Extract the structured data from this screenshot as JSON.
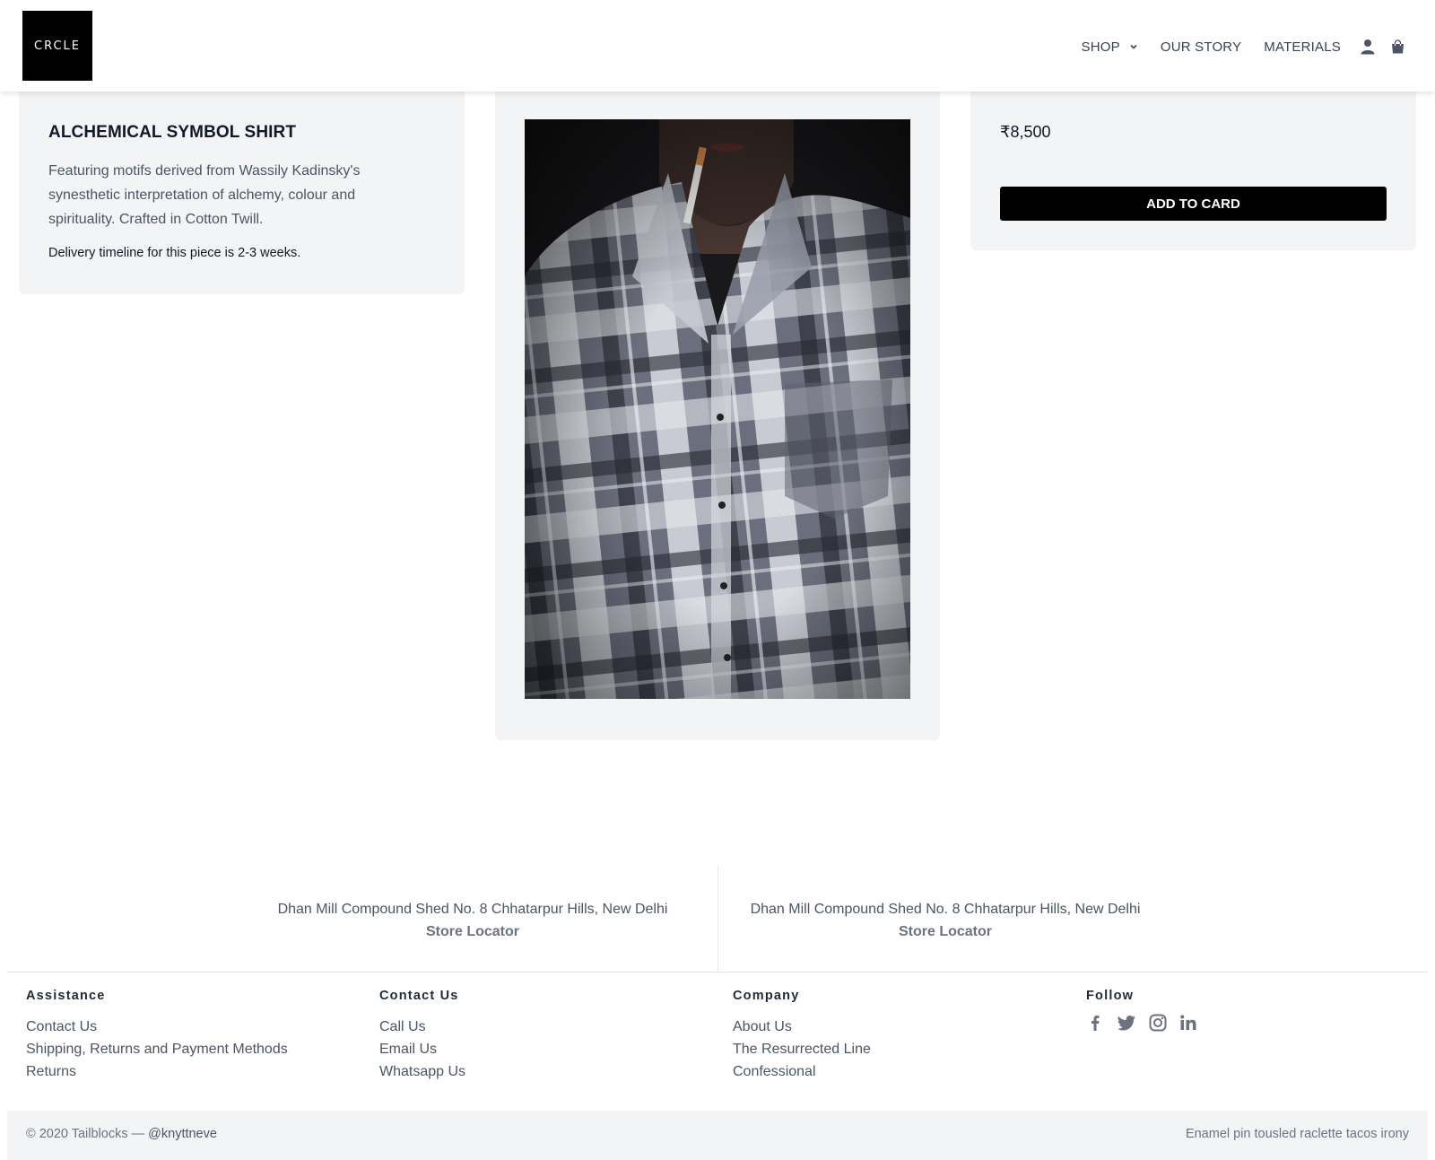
{
  "header": {
    "logo_text": "CRCLE",
    "nav": [
      {
        "label": "SHOP",
        "has_dropdown": true
      },
      {
        "label": "OUR STORY"
      },
      {
        "label": "MATERIALS"
      }
    ],
    "icons": [
      "user-icon",
      "shopping-bag-icon"
    ]
  },
  "product": {
    "title": "ALCHEMICAL SYMBOL SHIRT",
    "description": "Featuring motifs derived from Wassily Kadinsky's synesthetic interpretation of alchemy, colour and spirituality. Crafted in Cotton Twill.",
    "delivery_note": "Delivery timeline for this piece is 2-3 weeks.",
    "price": "₹8,500",
    "add_button_label": "ADD TO CARD",
    "image": {
      "subject": "model wearing grey plaid shirt with cigarette"
    }
  },
  "stores": [
    {
      "address": "Dhan Mill Compound Shed No. 8 Chhatarpur Hills, New Delhi",
      "link": "Store Locator"
    },
    {
      "address": "Dhan Mill Compound Shed No. 8 Chhatarpur Hills, New Delhi",
      "link": "Store Locator"
    }
  ],
  "footer": {
    "assistance": {
      "heading": "Assistance",
      "links": [
        "Contact Us",
        "Shipping, Returns and Payment Methods",
        "Returns"
      ]
    },
    "contact": {
      "heading": "Contact Us",
      "links": [
        "Call Us",
        "Email Us",
        "Whatsapp Us"
      ]
    },
    "company": {
      "heading": "Company",
      "links": [
        "About Us",
        "The Resurrected Line",
        "Confessional"
      ]
    },
    "follow": {
      "heading": "Follow",
      "icons": [
        "facebook-icon",
        "twitter-icon",
        "instagram-icon",
        "linkedin-icon"
      ]
    },
    "copyright": "© 2020 Tailblocks —",
    "handle": "@knyttneve",
    "tagline": "Enamel pin tousled raclette tacos irony"
  },
  "colors": {
    "accent": "#000000",
    "card_bg": "#f3f4f6",
    "text_muted": "#4b5563"
  }
}
